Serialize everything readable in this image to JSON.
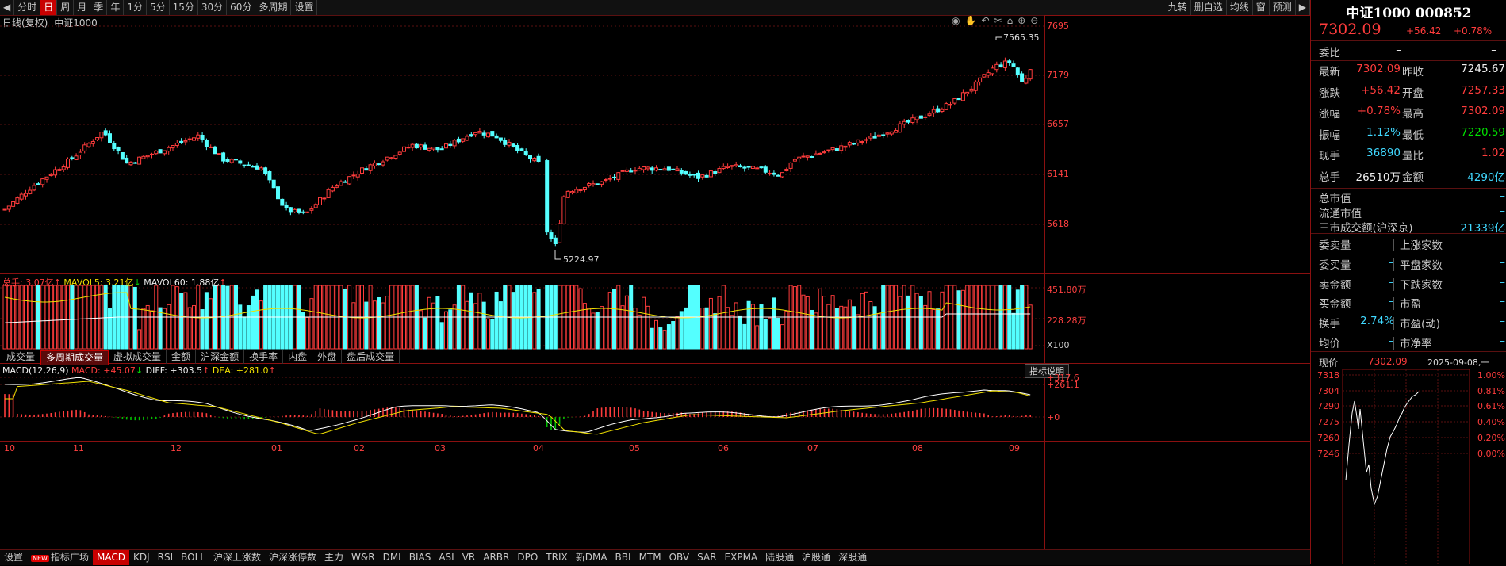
{
  "toolbar": {
    "items": [
      "分时",
      "日",
      "周",
      "月",
      "季",
      "年",
      "1分",
      "5分",
      "15分",
      "30分",
      "60分",
      "多周期",
      "设置"
    ],
    "active_index": 1,
    "right_items": [
      "九转",
      "删自选",
      "均线",
      "窗",
      "预测"
    ]
  },
  "main_chart": {
    "title": "日线(复权)",
    "index_name": "中证1000",
    "price_labels": [
      "7695",
      "7179",
      "6657",
      "6141",
      "5618"
    ],
    "high_marker": "7565.35",
    "low_marker": "5224.97",
    "month_labels": [
      "10",
      "11",
      "12",
      "01",
      "02",
      "03",
      "04",
      "05",
      "06",
      "07",
      "08",
      "09"
    ]
  },
  "volume": {
    "label": "总手: 3.07亿",
    "ma5": "MAVOL5: 3.21亿",
    "ma60": "MAVOL60: 1.88亿",
    "axis_top": "451.80万",
    "axis_mid": "228.28万",
    "axis_unit": "X100"
  },
  "vol_tabs": {
    "items": [
      "成交量",
      "多周期成交量",
      "虚拟成交量",
      "金额",
      "沪深金额",
      "换手率",
      "内盘",
      "外盘",
      "盘后成交量"
    ],
    "active_index": 1
  },
  "macd": {
    "params": "MACD(12,26,9)",
    "macd": "MACD: +45.07",
    "diff": "DIFF: +303.5",
    "dea": "DEA: +281.0",
    "explain_button": "指标说明",
    "axis": [
      "+317.6",
      "+261.1",
      "+0"
    ]
  },
  "bottombar": {
    "items": [
      "设置",
      "指标广场",
      "MACD",
      "KDJ",
      "RSI",
      "BOLL",
      "沪深上涨数",
      "沪深涨停数",
      "主力",
      "W&R",
      "DMI",
      "BIAS",
      "ASI",
      "VR",
      "ARBR",
      "DPO",
      "TRIX",
      "新DMA",
      "BBI",
      "MTM",
      "OBV",
      "SAR",
      "EXPMA",
      "陆股通",
      "沪股通",
      "深股通"
    ],
    "new_badge": "NEW",
    "active_index": 2
  },
  "quote": {
    "title": "中证1000 000852",
    "price": "7302.09",
    "change": "+56.42",
    "change_pct": "+0.78%",
    "weibi_label": "委比",
    "weibi_v1": "–",
    "weibi_v2": "–",
    "rows": [
      {
        "l1": "最新",
        "v1": "7302.09",
        "c1": "red",
        "l2": "昨收",
        "v2": "7245.67",
        "c2": "white"
      },
      {
        "l1": "涨跌",
        "v1": "+56.42",
        "c1": "red",
        "l2": "开盘",
        "v2": "7257.33",
        "c2": "red"
      },
      {
        "l1": "涨幅",
        "v1": "+0.78%",
        "c1": "red",
        "l2": "最高",
        "v2": "7302.09",
        "c2": "red"
      },
      {
        "l1": "振幅",
        "v1": "1.12%",
        "c1": "cyan",
        "l2": "最低",
        "v2": "7220.59",
        "c2": "green"
      },
      {
        "l1": "现手",
        "v1": "36890",
        "c1": "cyan",
        "l2": "量比",
        "v2": "1.02",
        "c2": "red"
      },
      {
        "l1": "总手",
        "v1": "26510万",
        "c1": "white",
        "l2": "金额",
        "v2": "4290亿",
        "c2": "cyan"
      }
    ],
    "mkt_rows": [
      {
        "l": "总市值",
        "v": "–"
      },
      {
        "l": "流通市值",
        "v": "–"
      },
      {
        "l": "三市成交额(沪深京)",
        "v": "21339亿"
      }
    ],
    "stat_rows": [
      {
        "l1": "委卖量",
        "v1": "–",
        "l2": "上涨家数",
        "v2": "–"
      },
      {
        "l1": "委买量",
        "v1": "–",
        "l2": "平盘家数",
        "v2": "–"
      },
      {
        "l1": "卖金额",
        "v1": "–",
        "l2": "下跌家数",
        "v2": "–"
      },
      {
        "l1": "买金额",
        "v1": "–",
        "l2": "市盈",
        "v2": "–"
      },
      {
        "l1": "换手",
        "v1": "2.74%",
        "l2": "市盈(动)",
        "v2": "–"
      },
      {
        "l1": "均价",
        "v1": "–",
        "l2": "市净率",
        "v2": "–"
      }
    ],
    "now_label": "现价",
    "now_price": "7302.09",
    "now_date": "2025-09-08,一"
  },
  "intraday": {
    "price_axis": [
      "7318",
      "7304",
      "7290",
      "7275",
      "7260",
      "7246"
    ],
    "pct_axis": [
      "1.00%",
      "0.81%",
      "0.61%",
      "0.40%",
      "0.20%",
      "0.00%"
    ]
  },
  "colors": {
    "up": "#ff3c3c",
    "down": "#54ffff",
    "bg": "#000000",
    "grid": "#5a1010",
    "accent": "#c80000"
  }
}
